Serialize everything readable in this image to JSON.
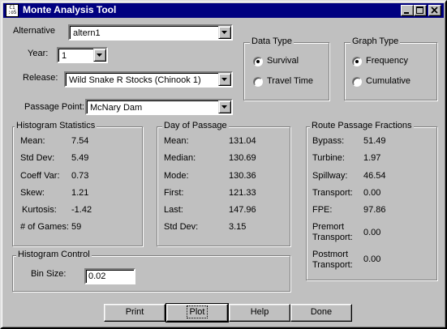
{
  "window": {
    "title": "Monte Analysis Tool",
    "icon_text": "C1\n:o5"
  },
  "selectors": {
    "alternative": {
      "label": "Alternative",
      "value": "altern1"
    },
    "year": {
      "label": "Year:",
      "value": "1"
    },
    "release": {
      "label": "Release:",
      "value": "Wild Snake R Stocks (Chinook 1)"
    },
    "passage_point": {
      "label": "Passage Point:",
      "value": "McNary Dam"
    }
  },
  "data_type": {
    "title": "Data Type",
    "options": [
      {
        "label": "Survival",
        "selected": true
      },
      {
        "label": "Travel Time",
        "selected": false
      }
    ]
  },
  "graph_type": {
    "title": "Graph Type",
    "options": [
      {
        "label": "Frequency",
        "selected": true
      },
      {
        "label": "Cumulative",
        "selected": false
      }
    ]
  },
  "histogram_stats": {
    "title": "Histogram Statistics",
    "rows": [
      {
        "label": "Mean:",
        "value": "7.54"
      },
      {
        "label": "Std Dev:",
        "value": "5.49"
      },
      {
        "label": "Coeff Var:",
        "value": "0.73"
      },
      {
        "label": "Skew:",
        "value": "1.21"
      },
      {
        "label": "Kurtosis:",
        "value": "-1.42"
      },
      {
        "label": "# of Games:",
        "value": "59"
      }
    ]
  },
  "day_of_passage": {
    "title": "Day of Passage",
    "rows": [
      {
        "label": "Mean:",
        "value": "131.04"
      },
      {
        "label": "Median:",
        "value": "130.69"
      },
      {
        "label": "Mode:",
        "value": "130.36"
      },
      {
        "label": "First:",
        "value": "121.33"
      },
      {
        "label": "Last:",
        "value": "147.96"
      },
      {
        "label": "Std Dev:",
        "value": "3.15"
      }
    ]
  },
  "route_passage": {
    "title": "Route Passage Fractions",
    "rows": [
      {
        "label": "Bypass:",
        "value": "51.49"
      },
      {
        "label": "Turbine:",
        "value": "1.97"
      },
      {
        "label": "Spillway:",
        "value": "46.54"
      },
      {
        "label": "Transport:",
        "value": "0.00"
      },
      {
        "label": "FPE:",
        "value": "97.86"
      }
    ],
    "premort_label_1": "Premort",
    "premort_label_2": "Transport:",
    "premort_value": "0.00",
    "postmort_label_1": "Postmort",
    "postmort_label_2": "Transport:",
    "postmort_value": "0.00"
  },
  "histogram_control": {
    "title": "Histogram Control",
    "bin_size_label": "Bin Size:",
    "bin_size_value": "0.02"
  },
  "buttons": {
    "print": "Print",
    "plot": "Plot",
    "help": "Help",
    "done": "Done"
  },
  "colors": {
    "titlebar": "#000080",
    "face": "#c0c0c0"
  }
}
